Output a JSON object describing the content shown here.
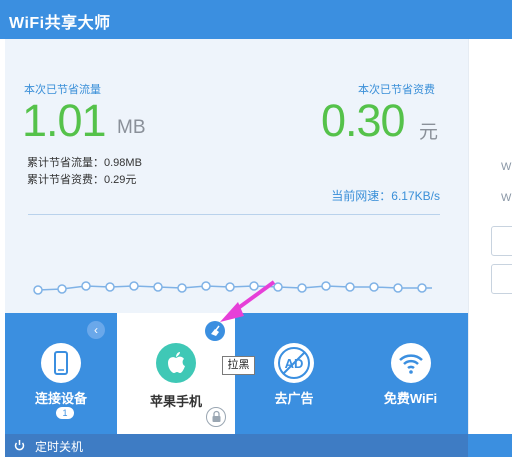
{
  "window": {
    "title": "WiFi共享大师"
  },
  "stats": {
    "flow_saved_label": "本次已节省流量",
    "flow_saved_value": "1.01",
    "flow_saved_unit": "MB",
    "money_saved_label": "本次已节省资费",
    "money_saved_value": "0.30",
    "money_saved_unit": "元",
    "total_flow": "累计节省流量：0.98MB",
    "total_money": "累计节省资费：0.29元",
    "speed": "当前网速：6.17KB/s"
  },
  "toolbar": {
    "items": [
      {
        "label": "连接设备",
        "badge": "1",
        "icon": "phone-icon"
      },
      {
        "label": "苹果手机",
        "icon": "apple-icon"
      },
      {
        "label": "去广告",
        "icon": "ad-block-icon"
      },
      {
        "label": "免费WiFi",
        "icon": "wifi-icon"
      }
    ],
    "tooltip": "拉黑"
  },
  "right_panel": {
    "w1": "W",
    "w2": "W"
  },
  "footer": {
    "label": "定时关机",
    "icon": "power-icon"
  },
  "colors": {
    "brand_blue": "#3b8fe0",
    "accent_green": "#55c24a",
    "arrow_magenta": "#e63fd8"
  }
}
